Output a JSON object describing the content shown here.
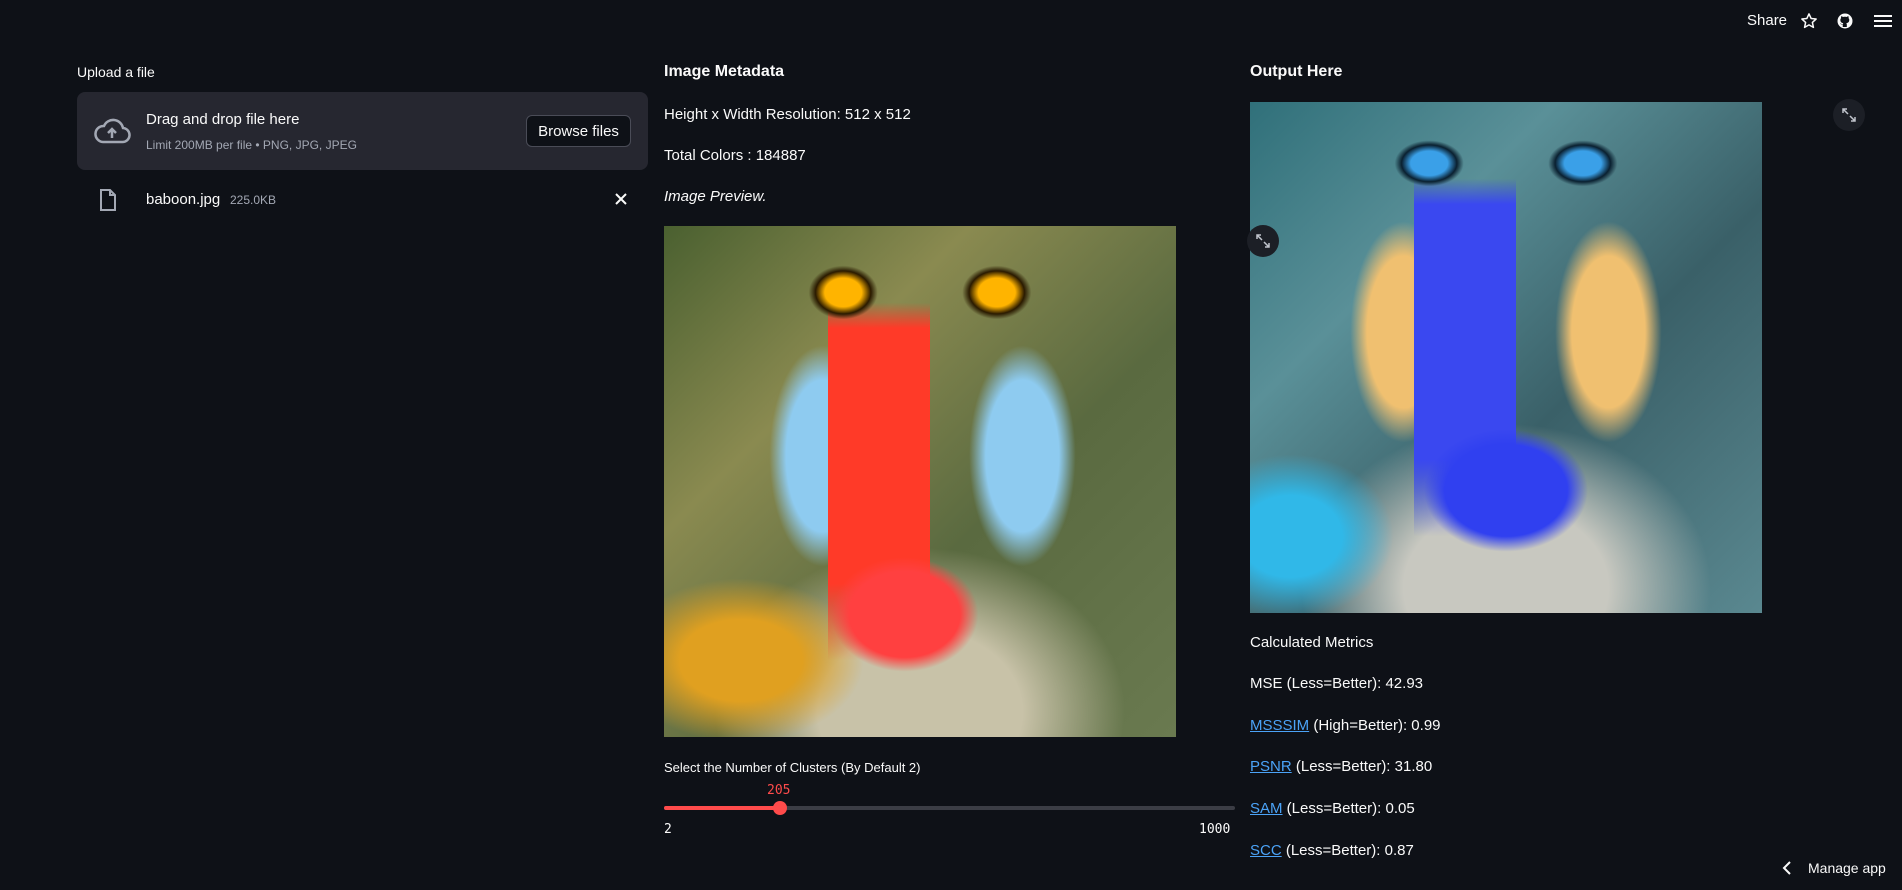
{
  "header": {
    "share_label": "Share",
    "icons": [
      "star-icon",
      "github-icon",
      "hamburger-menu-icon"
    ]
  },
  "upload": {
    "label": "Upload a file",
    "drop_title": "Drag and drop file here",
    "drop_hint": "Limit 200MB per file • PNG, JPG, JPEG",
    "browse_label": "Browse files",
    "file": {
      "name": "baboon.jpg",
      "size": "225.0KB"
    }
  },
  "metadata": {
    "heading": "Image Metadata",
    "resolution": "Height x Width Resolution: 512 x 512",
    "total_colors": "Total Colors : 184887",
    "preview_label": "Image Preview."
  },
  "slider": {
    "label": "Select the Number of Clusters (By Default 2)",
    "value": 205,
    "value_text": "205",
    "min_text": "2",
    "max_text": "1000",
    "min": 2,
    "max": 1000,
    "accent": "#ff4b4b"
  },
  "output": {
    "heading": "Output Here",
    "metrics_heading": "Calculated Metrics",
    "mse": "MSE (Less=Better): 42.93",
    "msssim_link": "MSSSIM",
    "msssim_rest": " (High=Better): 0.99",
    "psnr_link": "PSNR",
    "psnr_rest": " (Less=Better): 31.80",
    "sam_link": "SAM",
    "sam_rest": " (Less=Better): 0.05",
    "scc_link": "SCC",
    "scc_rest": " (Less=Better): 0.87"
  },
  "footer": {
    "manage_label": "Manage app"
  },
  "colors": {
    "background": "#0e1117",
    "link": "#4ba3f7",
    "panel": "#262730"
  }
}
